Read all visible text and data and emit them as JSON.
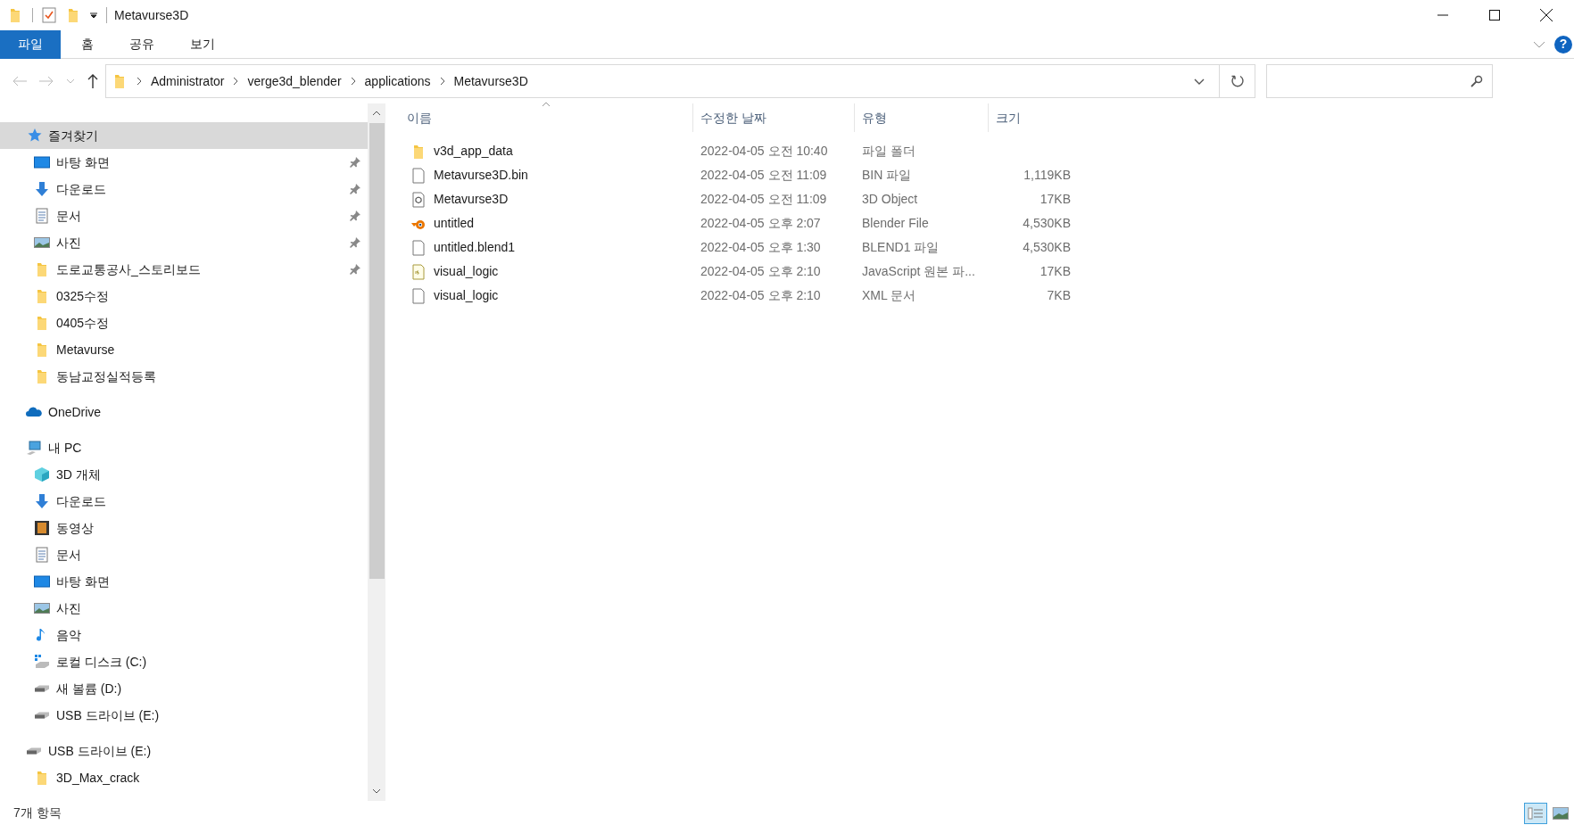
{
  "window": {
    "title": "Metavurse3D"
  },
  "ribbon_tabs": [
    {
      "label": "파일",
      "kind": "file"
    },
    {
      "label": "홈",
      "kind": "tab"
    },
    {
      "label": "공유",
      "kind": "tab"
    },
    {
      "label": "보기",
      "kind": "tab"
    }
  ],
  "help_button": "?",
  "breadcrumbs": [
    "Administrator",
    "verge3d_blender",
    "applications",
    "Metavurse3D"
  ],
  "sidebar": [
    {
      "label": "즐겨찾기",
      "kind": "star",
      "selected": true,
      "children": [
        {
          "label": "바탕 화면",
          "kind": "desktop",
          "pinned": true,
          "selected": false
        },
        {
          "label": "다운로드",
          "kind": "download",
          "pinned": true,
          "selected": false
        },
        {
          "label": "문서",
          "kind": "document",
          "pinned": true,
          "selected": false
        },
        {
          "label": "사진",
          "kind": "picture",
          "pinned": true,
          "selected": false
        },
        {
          "label": "도로교통공사_스토리보드",
          "kind": "folder",
          "pinned": true,
          "selected": false
        },
        {
          "label": "0325수정",
          "kind": "folder",
          "pinned": false,
          "selected": false
        },
        {
          "label": "0405수정",
          "kind": "folder",
          "pinned": false,
          "selected": false
        },
        {
          "label": "Metavurse",
          "kind": "folder",
          "pinned": false,
          "selected": false
        },
        {
          "label": "동남교정실적등록",
          "kind": "folder",
          "pinned": false,
          "selected": false
        }
      ]
    },
    {
      "label": "OneDrive",
      "kind": "cloud",
      "selected": false
    },
    {
      "label": "내 PC",
      "kind": "pc",
      "selected": false,
      "children": [
        {
          "label": "3D 개체",
          "kind": "cube",
          "pinned": false,
          "selected": false
        },
        {
          "label": "다운로드",
          "kind": "download",
          "pinned": false,
          "selected": false
        },
        {
          "label": "동영상",
          "kind": "video",
          "pinned": false,
          "selected": false
        },
        {
          "label": "문서",
          "kind": "document",
          "pinned": false,
          "selected": false
        },
        {
          "label": "바탕 화면",
          "kind": "desktop",
          "pinned": false,
          "selected": false
        },
        {
          "label": "사진",
          "kind": "picture",
          "pinned": false,
          "selected": false
        },
        {
          "label": "음악",
          "kind": "music",
          "pinned": false,
          "selected": false
        },
        {
          "label": "로컬 디스크 (C:)",
          "kind": "windrive",
          "pinned": false,
          "selected": false
        },
        {
          "label": "새 볼륨 (D:)",
          "kind": "drive",
          "pinned": false,
          "selected": false
        },
        {
          "label": "USB 드라이브 (E:)",
          "kind": "drive",
          "pinned": false,
          "selected": false
        }
      ]
    },
    {
      "label": "USB 드라이브 (E:)",
      "kind": "drive",
      "selected": false,
      "children": [
        {
          "label": "3D_Max_crack",
          "kind": "folder",
          "pinned": false,
          "selected": false
        }
      ]
    }
  ],
  "table": {
    "columns": [
      {
        "label": "이름",
        "sorted": true
      },
      {
        "label": "수정한 날짜",
        "sorted": false
      },
      {
        "label": "유형",
        "sorted": false
      },
      {
        "label": "크기",
        "sorted": false
      }
    ],
    "rows": [
      {
        "kind": "folder",
        "name": "v3d_app_data",
        "date": "2022-04-05 오전 10:40",
        "type": "파일 폴더"
      },
      {
        "kind": "file",
        "name": "Metavurse3D.bin",
        "date": "2022-04-05 오전 11:09",
        "type": "BIN 파일",
        "size": "1,119KB"
      },
      {
        "kind": "object3d",
        "name": "Metavurse3D",
        "date": "2022-04-05 오전 11:09",
        "type": "3D Object",
        "size": "17KB"
      },
      {
        "kind": "blender",
        "name": "untitled",
        "date": "2022-04-05 오후 2:07",
        "type": "Blender File",
        "size": "4,530KB"
      },
      {
        "kind": "file",
        "name": "untitled.blend1",
        "date": "2022-04-05 오후 1:30",
        "type": "BLEND1 파일",
        "size": "4,530KB"
      },
      {
        "kind": "js",
        "name": "visual_logic",
        "date": "2022-04-05 오후 2:10",
        "type": "JavaScript 원본 파...",
        "size": "17KB"
      },
      {
        "kind": "file",
        "name": "visual_logic",
        "date": "2022-04-05 오후 2:10",
        "type": "XML 문서",
        "size": "7KB"
      }
    ]
  },
  "status_bar": {
    "text": "7개 항목",
    "views": [
      {
        "kind": "details",
        "selected": true
      },
      {
        "kind": "large",
        "selected": false
      }
    ]
  }
}
